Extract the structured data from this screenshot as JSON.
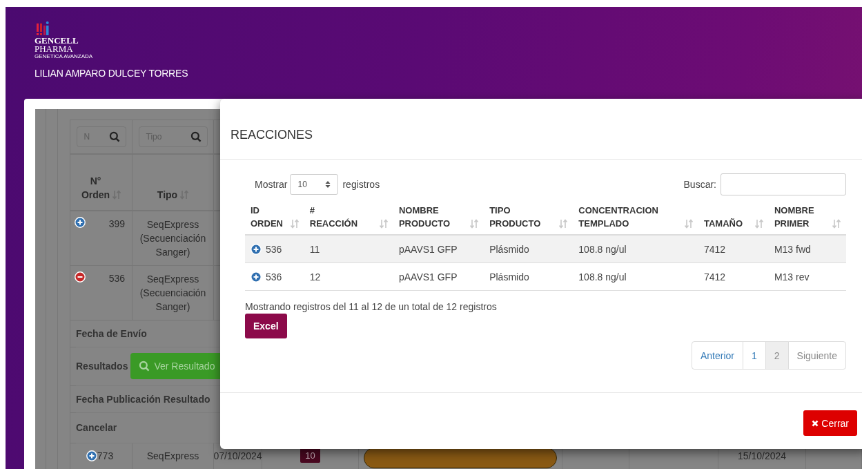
{
  "header": {
    "logo": {
      "line1": "GENCELL",
      "line2": "PHARMA",
      "tagline": "GENETICA AVANZADA"
    },
    "user": "LILIAN AMPARO DULCEY TORRES"
  },
  "orders_table": {
    "filters": [
      {
        "placeholder": "N"
      },
      {
        "placeholder": "Tipo"
      }
    ],
    "columns": [
      {
        "label": "N° Orden"
      },
      {
        "label": "Tipo"
      }
    ],
    "rows": [
      {
        "expanded": false,
        "number": "399",
        "type": "SeqExpress (Secuenciación Sanger)"
      },
      {
        "expanded": true,
        "number": "536",
        "type": "SeqExpress (Secuenciación Sanger)",
        "details": [
          {
            "label": "Fecha de Envío"
          },
          {
            "label": "Resultados",
            "button": "Ver Resultado"
          },
          {
            "label": "Fecha Publicación Resultado"
          },
          {
            "label": "Cancelar"
          }
        ]
      },
      {
        "expanded": false,
        "number": "773",
        "type": "SeqExpress",
        "date": "07/10/2024",
        "count": "10",
        "end_date": "15/10/2024"
      }
    ]
  },
  "modal": {
    "title": "REACCIONES",
    "length": {
      "prefix": "Mostrar",
      "value": "10",
      "suffix": "registros"
    },
    "search": {
      "label": "Buscar:"
    },
    "columns": [
      {
        "label": "ID ORDEN"
      },
      {
        "label": "# REACCIÓN"
      },
      {
        "label": "NOMBRE PRODUCTO"
      },
      {
        "label": "TIPO PRODUCTO"
      },
      {
        "label": "CONCENTRACION TEMPLADO"
      },
      {
        "label": "TAMAÑO"
      },
      {
        "label": "NOMBRE PRIMER"
      }
    ],
    "rows": [
      {
        "expanded": false,
        "cells": [
          "536",
          "11",
          "pAAVS1 GFP",
          "Plásmido",
          "108.8 ng/ul",
          "7412",
          "M13 fwd"
        ]
      },
      {
        "expanded": false,
        "cells": [
          "536",
          "12",
          "pAAVS1 GFP",
          "Plásmido",
          "108.8 ng/ul",
          "7412",
          "M13 rev"
        ]
      }
    ],
    "info": "Mostrando registros del 11 al 12 de un total de 12 registros",
    "excel_button": "Excel",
    "pagination": [
      {
        "label": "Anterior",
        "selected": false,
        "disabled": false
      },
      {
        "label": "1",
        "selected": false,
        "disabled": false
      },
      {
        "label": "2",
        "selected": true,
        "disabled": false
      },
      {
        "label": "Siguiente",
        "selected": false,
        "disabled": true
      }
    ],
    "close_button": "Cerrar"
  }
}
